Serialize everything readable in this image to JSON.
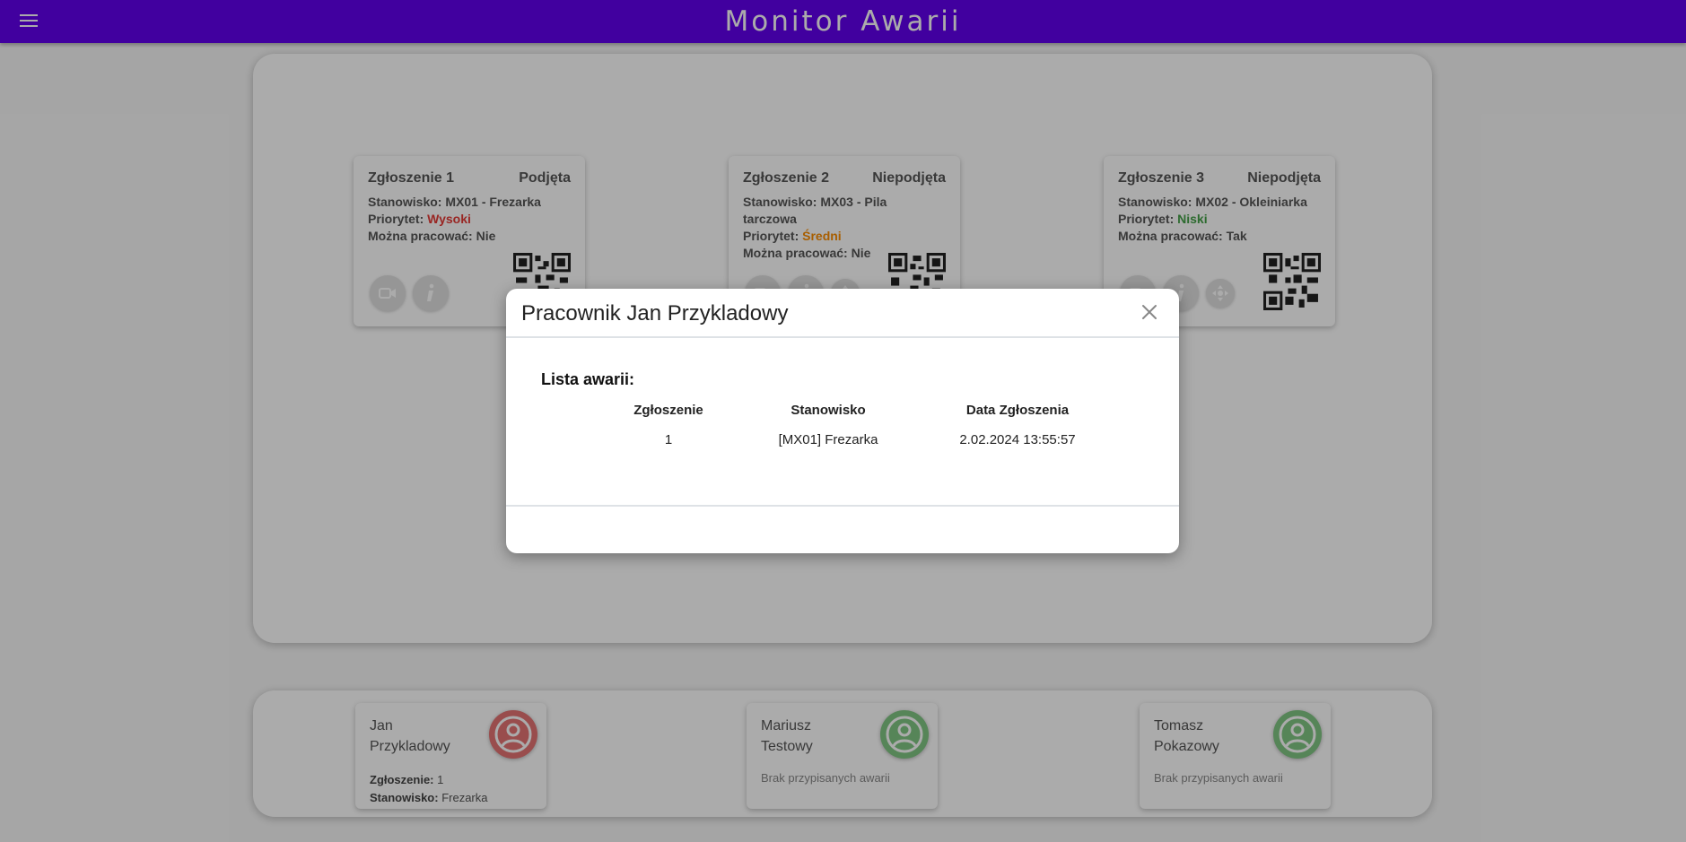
{
  "app": {
    "title": "Monitor Awarii"
  },
  "faults": [
    {
      "title": "Zgłoszenie 1",
      "status": "Podjęta",
      "station_label": "Stanowisko:",
      "station": "MX01 - Frezarka",
      "priority_label": "Priorytet:",
      "priority": "Wysoki",
      "priority_level": "high",
      "can_work_label": "Można pracować:",
      "can_work": "Nie",
      "buttons": [
        "camera-icon",
        "info-icon"
      ]
    },
    {
      "title": "Zgłoszenie 2",
      "status": "Niepodjęta",
      "station_label": "Stanowisko:",
      "station": "MX03 - Pila tarczowa",
      "priority_label": "Priorytet:",
      "priority": "Średni",
      "priority_level": "medium",
      "can_work_label": "Można pracować:",
      "can_work": "Nie",
      "buttons": [
        "camera-icon",
        "info-icon",
        "move-icon"
      ]
    },
    {
      "title": "Zgłoszenie 3",
      "status": "Niepodjęta",
      "station_label": "Stanowisko:",
      "station": "MX02 - Okleiniarka",
      "priority_label": "Priorytet:",
      "priority": "Niski",
      "priority_level": "low",
      "can_work_label": "Można pracować:",
      "can_work": "Tak",
      "buttons": [
        "camera-icon",
        "info-icon",
        "move-icon"
      ]
    }
  ],
  "workers": [
    {
      "name": "Jan Przykladowy",
      "status_color": "#e57373",
      "fault_label": "Zgłoszenie:",
      "fault": "1",
      "station_label": "Stanowisko:",
      "station": "Frezarka"
    },
    {
      "name": "Mariusz Testowy",
      "status_color": "#81c784",
      "empty": "Brak przypisanych awarii"
    },
    {
      "name": "Tomasz Pokazowy",
      "status_color": "#81c784",
      "empty": "Brak przypisanych awarii"
    }
  ],
  "colors": {
    "accent": "#6200ee",
    "high": "#e53935",
    "medium": "#fb8c00",
    "low": "#43a047"
  },
  "modal": {
    "title": "Pracownik Jan Przykladowy",
    "list_label": "Lista awarii:",
    "columns": [
      "Zgłoszenie",
      "Stanowisko",
      "Data Zgłoszenia"
    ],
    "rows": [
      [
        "1",
        "[MX01] Frezarka",
        "2.02.2024 13:55:57"
      ]
    ]
  }
}
